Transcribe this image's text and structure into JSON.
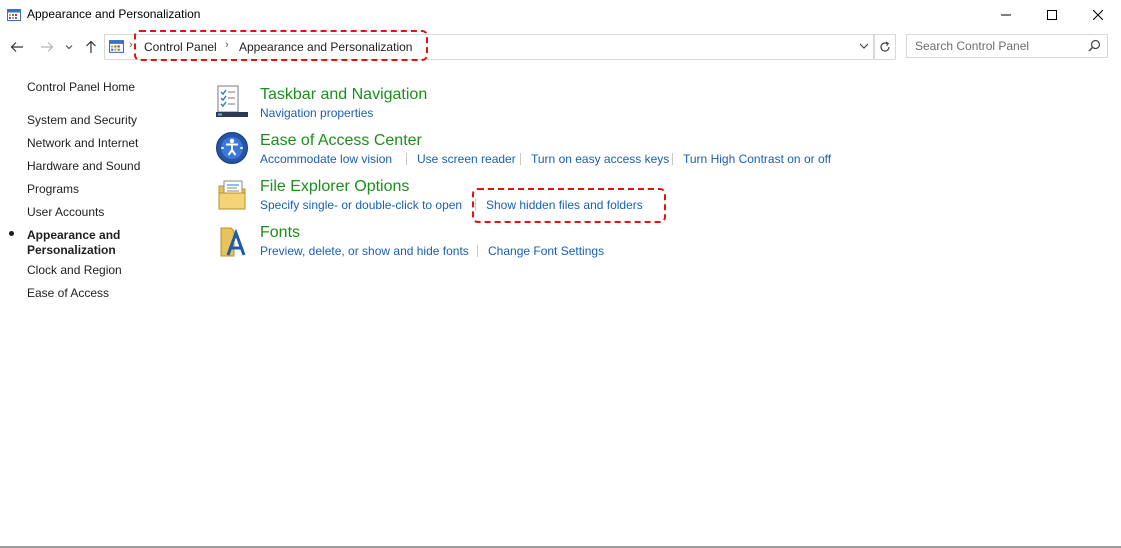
{
  "window": {
    "title": "Appearance and Personalization"
  },
  "address": {
    "crumbs": [
      "Control Panel",
      "Appearance and Personalization"
    ]
  },
  "search": {
    "placeholder": "Search Control Panel",
    "value": ""
  },
  "sidebar": {
    "home": "Control Panel Home",
    "items": [
      {
        "label": "System and Security"
      },
      {
        "label": "Network and Internet"
      },
      {
        "label": "Hardware and Sound"
      },
      {
        "label": "Programs"
      },
      {
        "label": "User Accounts"
      },
      {
        "label": "Appearance and Personalization",
        "active": true
      },
      {
        "label": "Clock and Region"
      },
      {
        "label": "Ease of Access"
      }
    ]
  },
  "categories": [
    {
      "title": "Taskbar and Navigation",
      "icon": "taskbar-icon",
      "tasks": [
        "Navigation properties"
      ]
    },
    {
      "title": "Ease of Access Center",
      "icon": "ease-of-access-icon",
      "tasks": [
        "Accommodate low vision",
        "Use screen reader",
        "Turn on easy access keys",
        "Turn High Contrast on or off"
      ]
    },
    {
      "title": "File Explorer Options",
      "icon": "folder-options-icon",
      "tasks": [
        "Specify single- or double-click to open",
        "Show hidden files and folders"
      ]
    },
    {
      "title": "Fonts",
      "icon": "fonts-icon",
      "tasks": [
        "Preview, delete, or show and hide fonts",
        "Change Font Settings"
      ]
    }
  ],
  "colors": {
    "link": "#1a5fb4",
    "category_title": "#1a8f1a",
    "highlight": "#e21212"
  }
}
